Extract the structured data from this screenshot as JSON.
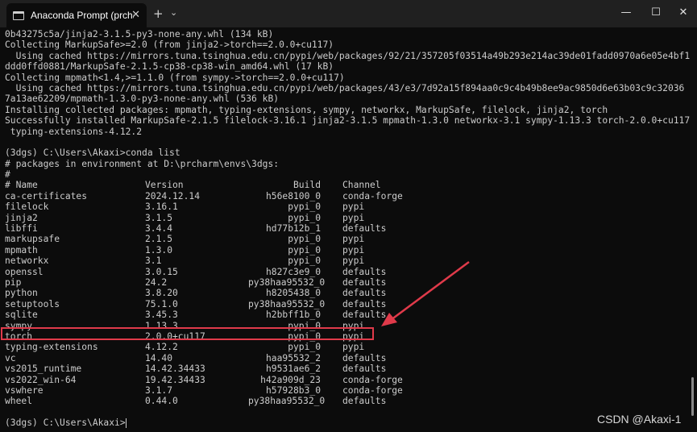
{
  "window": {
    "tab_title": "Anaconda Prompt (prcharm)",
    "tab_close": "✕",
    "new_tab": "+",
    "dropdown": "⌄",
    "minimize": "—",
    "maximize": "☐",
    "close": "✕"
  },
  "terminal": {
    "pre_lines": [
      "0b43275c5a/jinja2-3.1.5-py3-none-any.whl (134 kB)",
      "Collecting MarkupSafe>=2.0 (from jinja2->torch==2.0.0+cu117)",
      "  Using cached https://mirrors.tuna.tsinghua.edu.cn/pypi/web/packages/92/21/357205f03514a49b293e214ac39de01fadd0970a6e05e4bf1",
      "ddd0ffd0881/MarkupSafe-2.1.5-cp38-cp38-win_amd64.whl (17 kB)",
      "Collecting mpmath<1.4,>=1.1.0 (from sympy->torch==2.0.0+cu117)",
      "  Using cached https://mirrors.tuna.tsinghua.edu.cn/pypi/web/packages/43/e3/7d92a15f894aa0c9c4b49b8ee9ac9850d6e63b03c9c32036",
      "7a13ae62209/mpmath-1.3.0-py3-none-any.whl (536 kB)",
      "Installing collected packages: mpmath, typing-extensions, sympy, networkx, MarkupSafe, filelock, jinja2, torch",
      "Successfully installed MarkupSafe-2.1.5 filelock-3.16.1 jinja2-3.1.5 mpmath-1.3.0 networkx-3.1 sympy-1.13.3 torch-2.0.0+cu117",
      " typing-extensions-4.12.2",
      "",
      "(3dgs) C:\\Users\\Akaxi>conda list",
      "# packages in environment at D:\\prcharm\\envs\\3dgs:",
      "#"
    ],
    "header": {
      "name": "# Name",
      "version": "Version",
      "build": "Build",
      "channel": "Channel"
    },
    "packages": [
      {
        "name": "ca-certificates",
        "version": "2024.12.14",
        "build": "h56e8100_0",
        "channel": "conda-forge"
      },
      {
        "name": "filelock",
        "version": "3.16.1",
        "build": "pypi_0",
        "channel": "pypi"
      },
      {
        "name": "jinja2",
        "version": "3.1.5",
        "build": "pypi_0",
        "channel": "pypi"
      },
      {
        "name": "libffi",
        "version": "3.4.4",
        "build": "hd77b12b_1",
        "channel": "defaults"
      },
      {
        "name": "markupsafe",
        "version": "2.1.5",
        "build": "pypi_0",
        "channel": "pypi"
      },
      {
        "name": "mpmath",
        "version": "1.3.0",
        "build": "pypi_0",
        "channel": "pypi"
      },
      {
        "name": "networkx",
        "version": "3.1",
        "build": "pypi_0",
        "channel": "pypi"
      },
      {
        "name": "openssl",
        "version": "3.0.15",
        "build": "h827c3e9_0",
        "channel": "defaults"
      },
      {
        "name": "pip",
        "version": "24.2",
        "build": "py38haa95532_0",
        "channel": "defaults"
      },
      {
        "name": "python",
        "version": "3.8.20",
        "build": "h8205438_0",
        "channel": "defaults"
      },
      {
        "name": "setuptools",
        "version": "75.1.0",
        "build": "py38haa95532_0",
        "channel": "defaults"
      },
      {
        "name": "sqlite",
        "version": "3.45.3",
        "build": "h2bbff1b_0",
        "channel": "defaults"
      },
      {
        "name": "sympy",
        "version": "1.13.3",
        "build": "pypi_0",
        "channel": "pypi"
      },
      {
        "name": "torch",
        "version": "2.0.0+cu117",
        "build": "pypi_0",
        "channel": "pypi"
      },
      {
        "name": "typing-extensions",
        "version": "4.12.2",
        "build": "pypi_0",
        "channel": "pypi"
      },
      {
        "name": "vc",
        "version": "14.40",
        "build": "haa95532_2",
        "channel": "defaults"
      },
      {
        "name": "vs2015_runtime",
        "version": "14.42.34433",
        "build": "h9531ae6_2",
        "channel": "defaults"
      },
      {
        "name": "vs2022_win-64",
        "version": "19.42.34433",
        "build": "h42a909d_23",
        "channel": "conda-forge"
      },
      {
        "name": "vswhere",
        "version": "3.1.7",
        "build": "h57928b3_0",
        "channel": "conda-forge"
      },
      {
        "name": "wheel",
        "version": "0.44.0",
        "build": "py38haa95532_0",
        "channel": "defaults"
      }
    ],
    "prompt": "(3dgs) C:\\Users\\Akaxi>"
  },
  "annotation_color": "#e03a4a",
  "watermark": "CSDN @Akaxi-1"
}
